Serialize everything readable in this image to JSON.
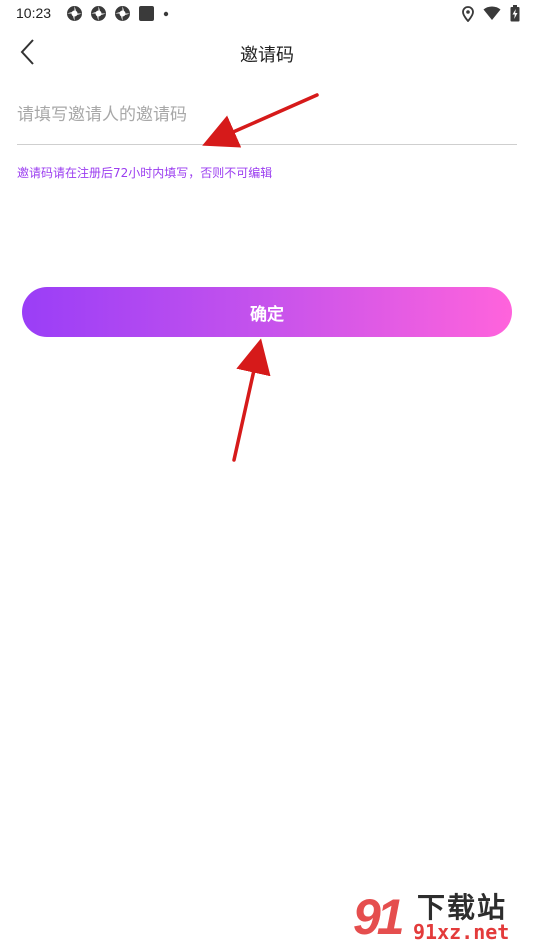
{
  "status_bar": {
    "time": "10:23"
  },
  "header": {
    "title": "邀请码"
  },
  "form": {
    "input_value": "",
    "input_placeholder": "请填写邀请人的邀请码",
    "hint": "邀请码请在注册后72小时内填写，否则不可编辑",
    "confirm_label": "确定"
  },
  "watermark": {
    "number": "91",
    "title": "下载站",
    "url": "91xz.net"
  },
  "colors": {
    "accent": "#9b3df0",
    "button_gradient_start": "#9a3ef7",
    "button_gradient_end": "#ff63dc",
    "annotation_arrow": "#d61a1a"
  }
}
